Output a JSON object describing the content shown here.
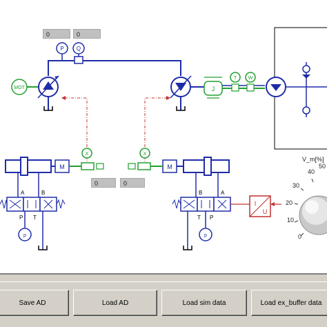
{
  "readouts": {
    "pressure": "0",
    "flow": "0",
    "pos_left": "0",
    "pos_right": "0"
  },
  "labels": {
    "motor": "MOT",
    "P": "P",
    "Q": "Q",
    "T": "T",
    "W": "W",
    "J": "J",
    "X": "X",
    "M": "M",
    "A": "A",
    "B": "B",
    "Pport": "P",
    "Tport": "T",
    "I": "I",
    "U": "U",
    "p": "p"
  },
  "dial": {
    "title": "V_m[%]",
    "ticks": [
      "40",
      "50",
      "30",
      "20",
      "10",
      "0"
    ]
  },
  "buttons": {
    "save_ad": "Save AD",
    "load_ad": "Load AD",
    "load_sim": "Load sim data",
    "load_ex": "Load ex_buffer data"
  },
  "colors": {
    "hydraulic": "#1f2ca8",
    "sensor": "#22a030",
    "signal": "#c03030"
  }
}
